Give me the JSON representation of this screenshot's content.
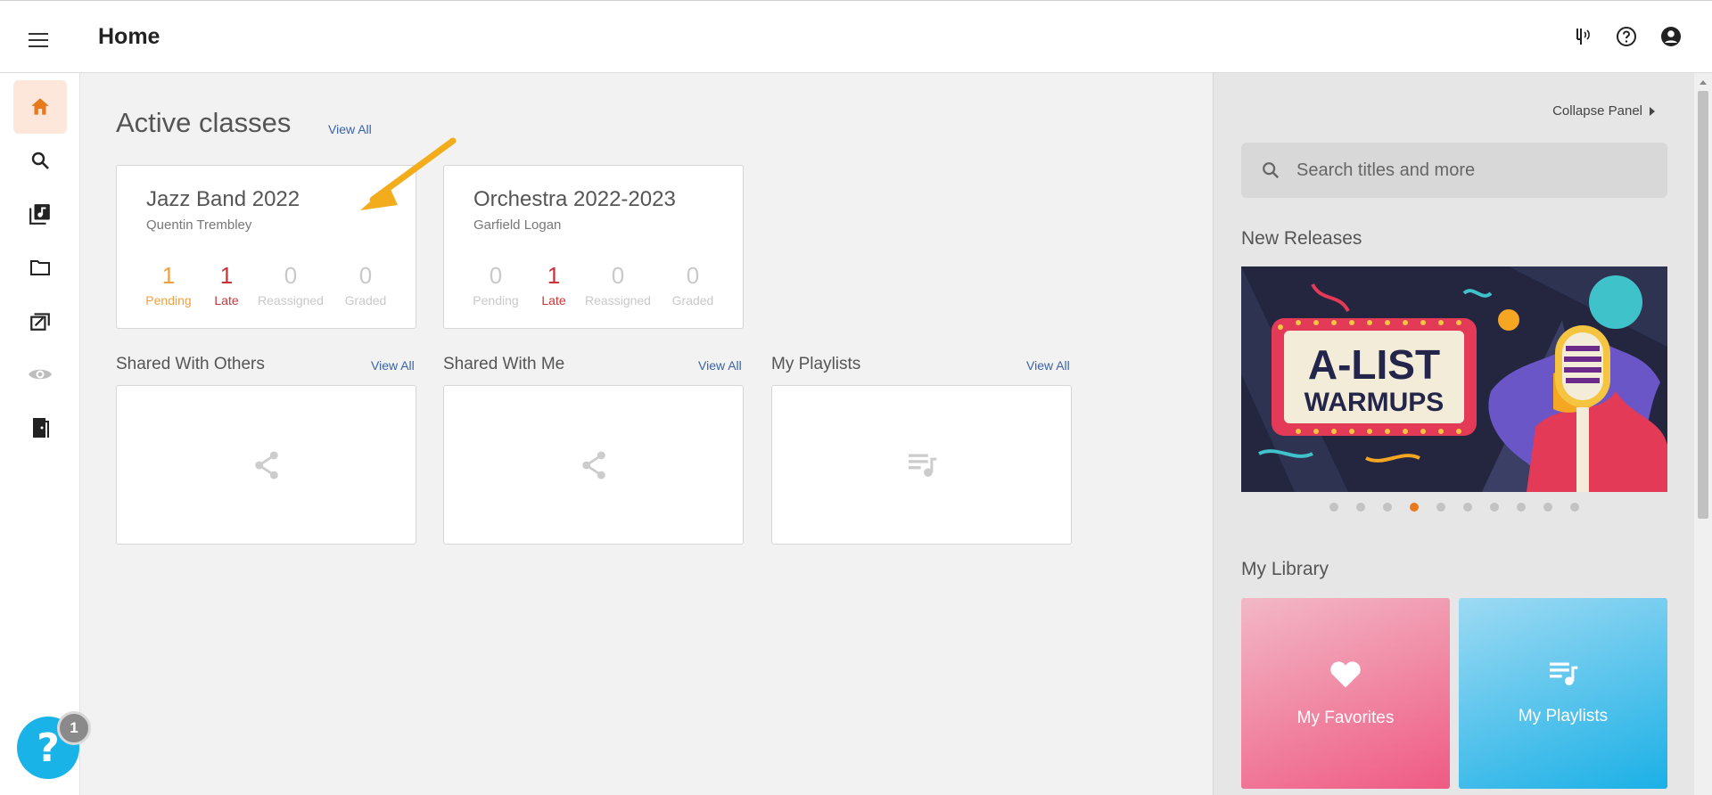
{
  "header": {
    "title": "Home"
  },
  "main": {
    "active_classes_title": "Active classes",
    "view_all": "View All",
    "classes": [
      {
        "name": "Jazz Band 2022",
        "teacher": "Quentin Trembley",
        "stats": [
          {
            "value": "1",
            "label": "Pending"
          },
          {
            "value": "1",
            "label": "Late"
          },
          {
            "value": "0",
            "label": "Reassigned"
          },
          {
            "value": "0",
            "label": "Graded"
          }
        ]
      },
      {
        "name": "Orchestra 2022-2023",
        "teacher": "Garfield Logan",
        "stats": [
          {
            "value": "0",
            "label": "Pending"
          },
          {
            "value": "1",
            "label": "Late"
          },
          {
            "value": "0",
            "label": "Reassigned"
          },
          {
            "value": "0",
            "label": "Graded"
          }
        ]
      }
    ],
    "shared_with_others": "Shared With Others",
    "shared_with_me": "Shared With Me",
    "my_playlists": "My Playlists"
  },
  "panel": {
    "collapse_label": "Collapse Panel",
    "search_placeholder": "Search titles and more",
    "new_releases": "New Releases",
    "banner_line1": "A-LIST",
    "banner_line2": "WARMUPS",
    "carousel_active_index": 3,
    "carousel_count": 10,
    "my_library": "My Library",
    "favorites_label": "My Favorites",
    "playlists_label": "My Playlists"
  },
  "help": {
    "badge_count": "1",
    "glyph": "?"
  },
  "colors": {
    "accent": "#e87a1d",
    "pending": "#f0a040",
    "late": "#c8343a",
    "link": "#3a63a8"
  }
}
